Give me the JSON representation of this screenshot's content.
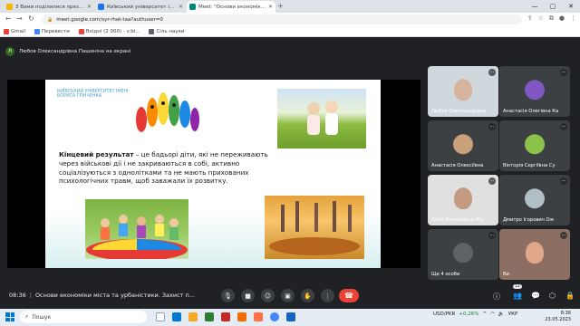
{
  "browser": {
    "tabs": [
      {
        "label": "З Вами поділилися презентацією",
        "color": "#f4b400",
        "active": false
      },
      {
        "label": "Київський університет імені Бо",
        "color": "#1a73e8",
        "active": false
      },
      {
        "label": "Meet: \"Основи економіки \"",
        "color": "#00897b",
        "active": true
      }
    ],
    "new_tab": "+",
    "url": "meet.google.com/syr-rhat-taa?authuser=0",
    "bookmarks": [
      {
        "label": "Gmail",
        "color": "#ea4335"
      },
      {
        "label": "Перевести",
        "color": "#4285f4"
      },
      {
        "label": "Вхідні (2 000) - v.bi...",
        "color": "#ea4335"
      },
      {
        "label": "Сіль науки",
        "color": "#5f6368"
      }
    ]
  },
  "meet": {
    "presenter": {
      "initial": "Л",
      "label": "Любов Олександрівна Пашиніна на екрані"
    },
    "slide": {
      "university": "КИЇВСЬКИЙ УНІВЕРСИТЕТ ІМЕНІ БОРИСА ГРІНЧЕНКА",
      "lead": "Кінцевий результат",
      "body": " – це бадьорі діти, які не переживають через військові дії і не закриваються в собі, активно соціалізуються з однолітками та не мають прихованих психологічних травм, щоб заважали їх розвитку."
    },
    "participants": [
      {
        "name": "Любов Олександрівна",
        "style": "cam",
        "bg": "#cfd8dc",
        "face": "#d7b49e"
      },
      {
        "name": "Анастасія Олегівна Ка",
        "style": "avatar",
        "bg": "#3c4043",
        "face": "#7e57c2"
      },
      {
        "name": "Анастасія Олексіївна",
        "style": "avatar",
        "bg": "#3c4043",
        "face": "#c9a07a"
      },
      {
        "name": "Вікторія Сергіївна Су",
        "style": "avatar",
        "bg": "#3c4043",
        "face": "#8bc34a"
      },
      {
        "name": "Юлія Миколаївна Жу",
        "style": "cam",
        "bg": "#e0e0e0",
        "face": "#c49a80"
      },
      {
        "name": "Дмитро Ігорович Ож",
        "style": "avatar",
        "bg": "#3c4043",
        "face": "#b0bec5"
      },
      {
        "name": "Ще 4 особи",
        "style": "more",
        "bg": "#3c4043",
        "face": "#5f6368"
      },
      {
        "name": "Ви",
        "style": "cam",
        "bg": "#8d6e63",
        "face": "#e0a88a"
      }
    ],
    "time": "08:36",
    "meeting_title": "Основи економіки міста та урбаністики. Захист п...",
    "participant_count": "12",
    "controls": [
      "mic-icon",
      "camera-icon",
      "captions-icon",
      "emoji-icon",
      "present-icon",
      "raise-hand-icon",
      "more-icon"
    ]
  },
  "taskbar": {
    "search_label": "Пошук",
    "currency": "USD/PKR",
    "change": "+0,26%",
    "lang": "УКР",
    "time": "8:36",
    "date": "23.05.2023"
  }
}
